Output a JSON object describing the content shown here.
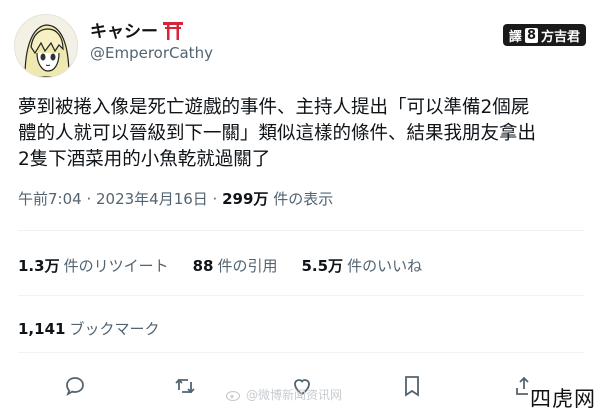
{
  "user": {
    "display_name": "キャシー",
    "handle": "@EmperorCathy",
    "avatar_icon": "anime-avatar-icon",
    "name_emoji": "torii-gate-icon"
  },
  "translator_badge": {
    "prefix": "譯",
    "number": "8",
    "name": "方吉君"
  },
  "tweet": {
    "text": "夢到被捲入像是死亡遊戲的事件、主持人提出「可以準備2個屍\n體的人就可以晉級到下一關」類似這樣的條件、結果我朋友拿出\n2隻下酒菜用的小魚乾就過關了"
  },
  "meta": {
    "timestamp": "午前7:04 · 2023年4月16日 · ",
    "views_count": "299万",
    "views_label": " 件の表示"
  },
  "stats": {
    "retweets_count": "1.3万",
    "retweets_label": "件のリツイート",
    "quotes_count": "88",
    "quotes_label": "件の引用",
    "likes_count": "5.5万",
    "likes_label": "件のいいね"
  },
  "bookmarks": {
    "count": "1,141",
    "label": "ブックマーク"
  },
  "actions": {
    "icons": [
      "reply-icon",
      "retweet-icon",
      "like-icon",
      "bookmark-icon",
      "share-icon"
    ]
  },
  "watermark": {
    "text": "@微博新闻资讯网"
  },
  "corner_brand": {
    "text": "四虎网"
  },
  "colors": {
    "text": "#0f1419",
    "secondary": "#536471",
    "divider": "#eff3f4",
    "torii": "#d6253a"
  }
}
